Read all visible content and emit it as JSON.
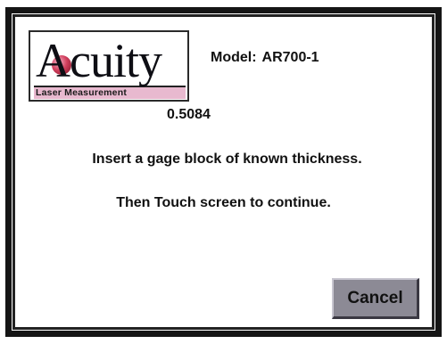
{
  "logo": {
    "brand": "Acuity",
    "tagline": "Laser Measurement"
  },
  "model": {
    "label": "Model:",
    "value": "AR700-1"
  },
  "reading": "0.5084",
  "instructions": {
    "line1": "Insert a gage block of known thickness.",
    "line2": "Then Touch screen to continue."
  },
  "buttons": {
    "cancel": "Cancel"
  },
  "colors": {
    "frame": "#151515",
    "button_face": "#8c8a95",
    "logo_tagline_bg": "#e8b9cf",
    "logo_ball": "#d2405e"
  }
}
